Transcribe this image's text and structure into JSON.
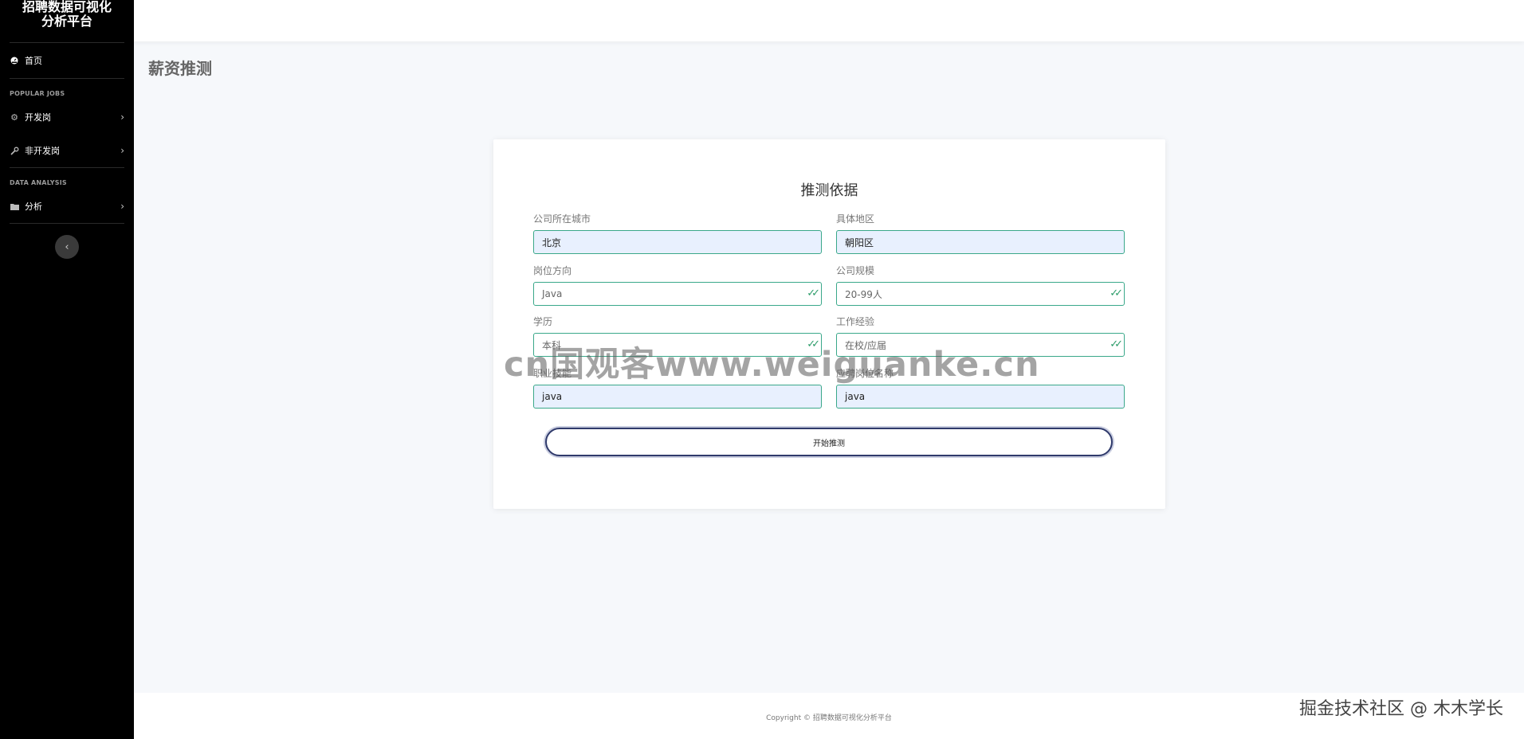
{
  "sidebar": {
    "brand_line1": "招聘数据可视化",
    "brand_line2": "分析平台",
    "home_label": "首页",
    "section_popular": "POPULAR JOBS",
    "dev_label": "开发岗",
    "nondev_label": "非开发岗",
    "section_analysis": "DATA ANALYSIS",
    "analysis_label": "分析"
  },
  "page": {
    "title": "薪资推测"
  },
  "form": {
    "title": "推测依据",
    "city_label": "公司所在城市",
    "city_value": "北京",
    "district_label": "具体地区",
    "district_value": "朝阳区",
    "direction_label": "岗位方向",
    "direction_value": "Java",
    "scale_label": "公司规模",
    "scale_value": "20-99人",
    "education_label": "学历",
    "education_value": "本科",
    "experience_label": "工作经验",
    "experience_value": "在校/应届",
    "skill_label": "职业技能",
    "skill_value": "java",
    "position_label": "应聘岗位名称",
    "position_value": "java",
    "submit_label": "开始推测"
  },
  "footer": {
    "copyright": "Copyright © 招聘数据可视化分析平台"
  },
  "overlays": {
    "watermark": "cn国观客www.weiguanke.cn",
    "juejin": "掘金技术社区 @ 木木学长"
  },
  "colors": {
    "sidebar_bg": "#000000",
    "field_border": "#3aa88a",
    "autofill_bg": "#e8f0fe",
    "button_border": "#2f3a6b"
  }
}
